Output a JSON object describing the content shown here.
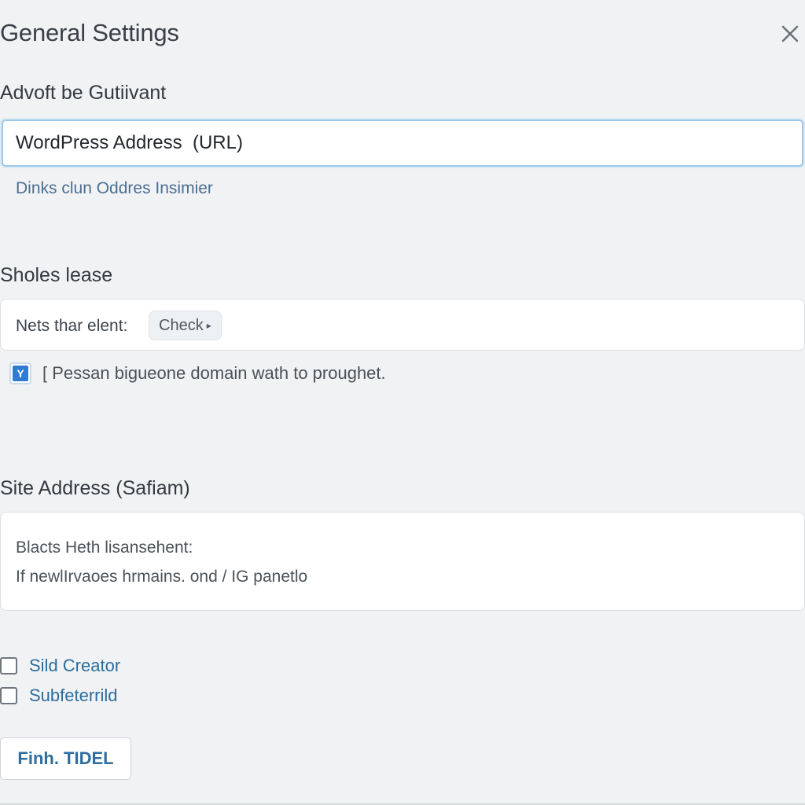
{
  "dialog": {
    "title": "General Settings",
    "close_icon": "close-icon"
  },
  "section1": {
    "label": "Advoft be Gutiivant",
    "url_input_value": "WordPress Address  (URL)",
    "hint_link": "Dinks clun Oddres Insimier"
  },
  "section2": {
    "label": "Sholes lease",
    "row_label": "Nets thar elent:",
    "check_button": "Check",
    "check_button_arrow": "▸",
    "checkbox_glyph": "Y",
    "checkbox_text": "[ Pessan bigueone domain wath to proughet.",
    "checkbox_checked": true
  },
  "section3": {
    "label": "Site Address (Safiam)",
    "line1": "Blacts Heth lisansehent:",
    "line2": "If newlIrvaoes hrmains. ond / IG panetlo"
  },
  "options": [
    {
      "label": "Sild Creator",
      "checked": false
    },
    {
      "label": "Subfeterrild",
      "checked": false
    }
  ],
  "footer": {
    "finish_button": "Finh. TIDEL"
  },
  "colors": {
    "background": "#f1f2f4",
    "input_focus_border": "#9fc7e6",
    "link": "#4b6f92",
    "option_label": "#2a6d9c",
    "checkbox_accent": "#2f7bd1"
  }
}
